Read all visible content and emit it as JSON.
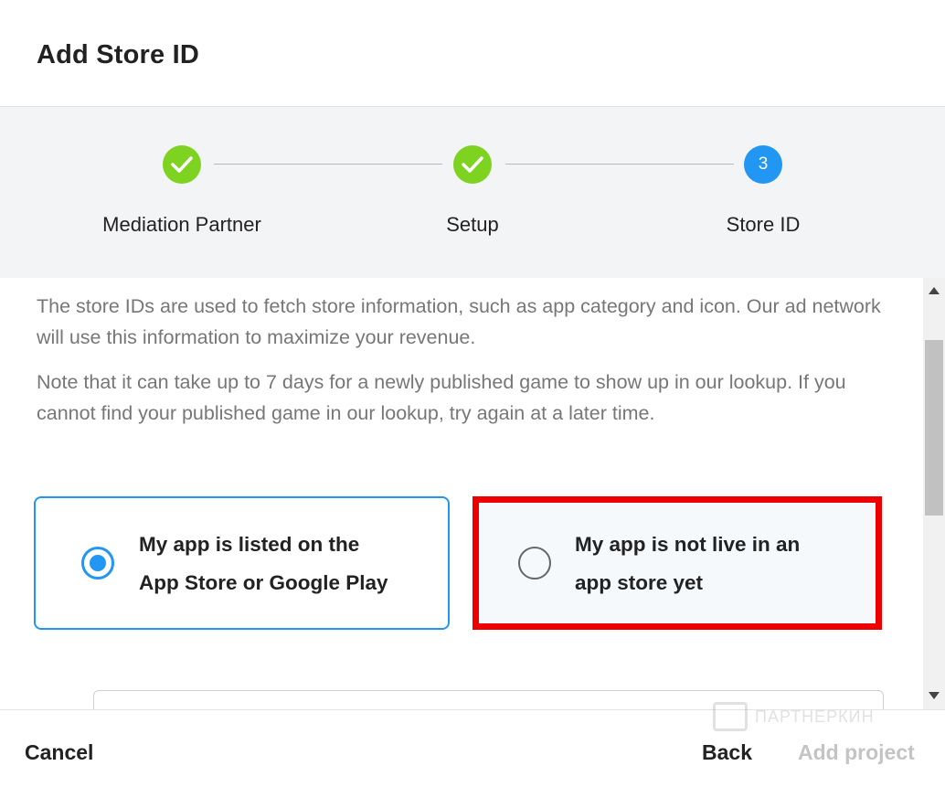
{
  "dialog": {
    "title": "Add Store ID"
  },
  "stepper": {
    "steps": [
      {
        "label": "Mediation Partner",
        "status": "done"
      },
      {
        "label": "Setup",
        "status": "done"
      },
      {
        "label": "Store ID",
        "status": "active",
        "number": "3"
      }
    ],
    "colors": {
      "done": "#7ed321",
      "active": "#2196f3"
    }
  },
  "content": {
    "paragraph1": "The store IDs are used to fetch store information, such as app category and icon. Our ad network will use this information to maximize your revenue.",
    "paragraph2": "Note that it can take up to 7 days for a newly published game to show up in our lookup. If you cannot find your published game in our lookup, try again at a later time."
  },
  "options": [
    {
      "label_line1": "My app is listed on the",
      "label_line2": "App Store or Google Play",
      "selected": true
    },
    {
      "label_line1": "My app is not live in an",
      "label_line2": "app store yet",
      "selected": false,
      "highlighted": true
    }
  ],
  "footer": {
    "cancel_label": "Cancel",
    "back_label": "Back",
    "add_label": "Add project"
  },
  "watermark": {
    "text": "ПАРТНЕРКИН"
  },
  "colors": {
    "accent": "#2196f3",
    "highlight": "#ee0000",
    "disabled": "#c4c4c4"
  }
}
